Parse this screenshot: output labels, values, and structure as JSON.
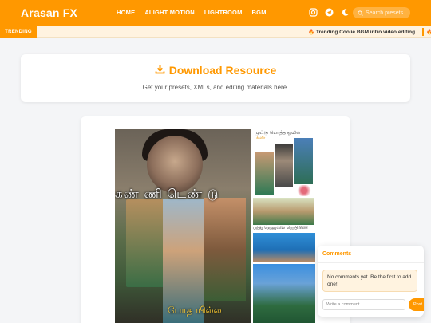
{
  "header": {
    "logo": "Arasan FX",
    "nav": [
      "HOME",
      "ALIGHT MOTION",
      "LIGHTROOM",
      "BGM"
    ],
    "icons": [
      "instagram-icon",
      "telegram-icon",
      "moon-icon"
    ],
    "search_placeholder": "Search presets..."
  },
  "trending": {
    "label": "TRENDING",
    "item": "🔥 Trending Coolie BGM intro video editing",
    "next_item": "🔥"
  },
  "download": {
    "title": "Download Resource",
    "subtitle": "Get your presets, XMLs, and editing materials here."
  },
  "thumbnail": {
    "tamil_overlay": "கண் ணி  டெண் டு",
    "tamil_bottom": "போத யில்ல",
    "right_caption": "முட்டு மொத்த ஒயில",
    "right_caption2": "கிளீர்",
    "right_caption3": "பந்து ஜெனுவில் ஜெயின்ஸி"
  },
  "comments": {
    "title": "Comments",
    "empty_text": "No comments yet. Be the first to add one!",
    "input_placeholder": "Write a comment...",
    "post_label": "Post"
  },
  "colors": {
    "accent": "#ff9800",
    "trending_bg": "#fff3e0",
    "page_bg": "#f4f5f7"
  }
}
